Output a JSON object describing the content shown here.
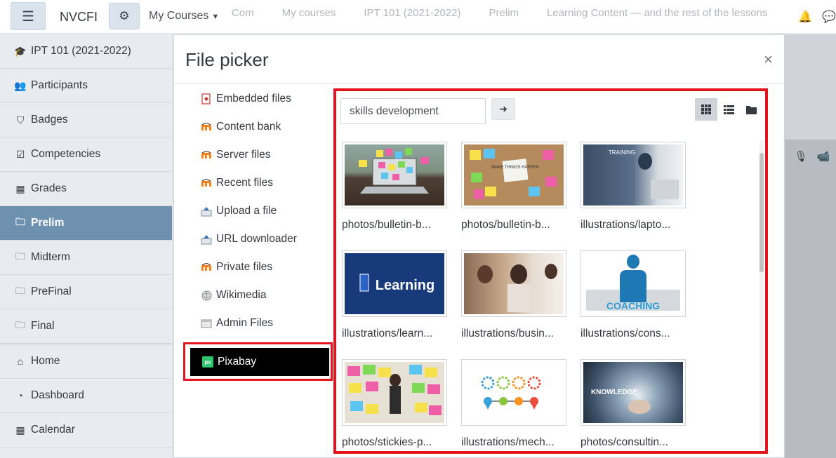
{
  "navbar": {
    "brand": "NVCFI",
    "my_courses": "My Courses",
    "links": [
      "Com",
      "My courses",
      "IPT 101 (2021-2022)",
      "Prelim",
      "Learning Content — and the rest of the lessons"
    ]
  },
  "drawer": {
    "items": [
      {
        "label": "IPT 101 (2021-2022)",
        "icon": "graduation-cap-icon",
        "glyph": "🎓"
      },
      {
        "label": "Participants",
        "icon": "users-icon",
        "glyph": "👥"
      },
      {
        "label": "Badges",
        "icon": "shield-icon",
        "glyph": "⛉"
      },
      {
        "label": "Competencies",
        "icon": "check-square-icon",
        "glyph": "☑"
      },
      {
        "label": "Grades",
        "icon": "table-icon",
        "glyph": "▦"
      },
      {
        "label": "Prelim",
        "icon": "folder-icon",
        "glyph": "🗀",
        "active": true
      },
      {
        "label": "Midterm",
        "icon": "folder-icon",
        "glyph": "🗀"
      },
      {
        "label": "PreFinal",
        "icon": "folder-icon",
        "glyph": "🗀"
      },
      {
        "label": "Final",
        "icon": "folder-icon",
        "glyph": "🗀"
      }
    ],
    "items2": [
      {
        "label": "Home",
        "icon": "home-icon",
        "glyph": "⌂"
      },
      {
        "label": "Dashboard",
        "icon": "dashboard-icon",
        "glyph": "◔"
      },
      {
        "label": "Calendar",
        "icon": "calendar-icon",
        "glyph": "▦"
      }
    ]
  },
  "modal": {
    "title": "File picker",
    "close": "×",
    "repositories": [
      {
        "label": "Embedded files",
        "icon": "embedded-files-icon"
      },
      {
        "label": "Content bank",
        "icon": "moodle-icon"
      },
      {
        "label": "Server files",
        "icon": "moodle-icon"
      },
      {
        "label": "Recent files",
        "icon": "moodle-icon"
      },
      {
        "label": "Upload a file",
        "icon": "upload-icon"
      },
      {
        "label": "URL downloader",
        "icon": "url-icon"
      },
      {
        "label": "Private files",
        "icon": "moodle-icon"
      },
      {
        "label": "Wikimedia",
        "icon": "wikimedia-icon"
      },
      {
        "label": "Admin Files",
        "icon": "admin-files-icon"
      }
    ],
    "active_repository": {
      "label": "Pixabay",
      "icon": "pixabay-icon",
      "logo_text": "px"
    },
    "search": {
      "value": "skills development"
    },
    "view_modes": [
      "icons",
      "list",
      "tree"
    ],
    "active_view": "icons",
    "files": [
      {
        "label": "photos/bulletin-b...",
        "image": "laptop-sticky-notes"
      },
      {
        "label": "photos/bulletin-b...",
        "image": "cork-board-notes",
        "caption": "MAKE THINGS HAPPEN"
      },
      {
        "label": "illustrations/lapto...",
        "image": "training-laptop",
        "caption": "TRAINING"
      },
      {
        "label": "illustrations/learn...",
        "image": "learning-banner",
        "caption": "Learning"
      },
      {
        "label": "illustrations/busin...",
        "image": "business-people"
      },
      {
        "label": "illustrations/cons...",
        "image": "coaching-silhouette",
        "caption": "COACHING"
      },
      {
        "label": "photos/stickies-p...",
        "image": "stickies-wall"
      },
      {
        "label": "illustrations/mech...",
        "image": "gears-pins"
      },
      {
        "label": "photos/consultin...",
        "image": "consulting-words",
        "caption": "KNOWLEDGE"
      }
    ]
  },
  "colors": {
    "highlight": "#e3141e",
    "drawer_active": "#6f91b0",
    "pixabay_green": "#2ec66d"
  }
}
